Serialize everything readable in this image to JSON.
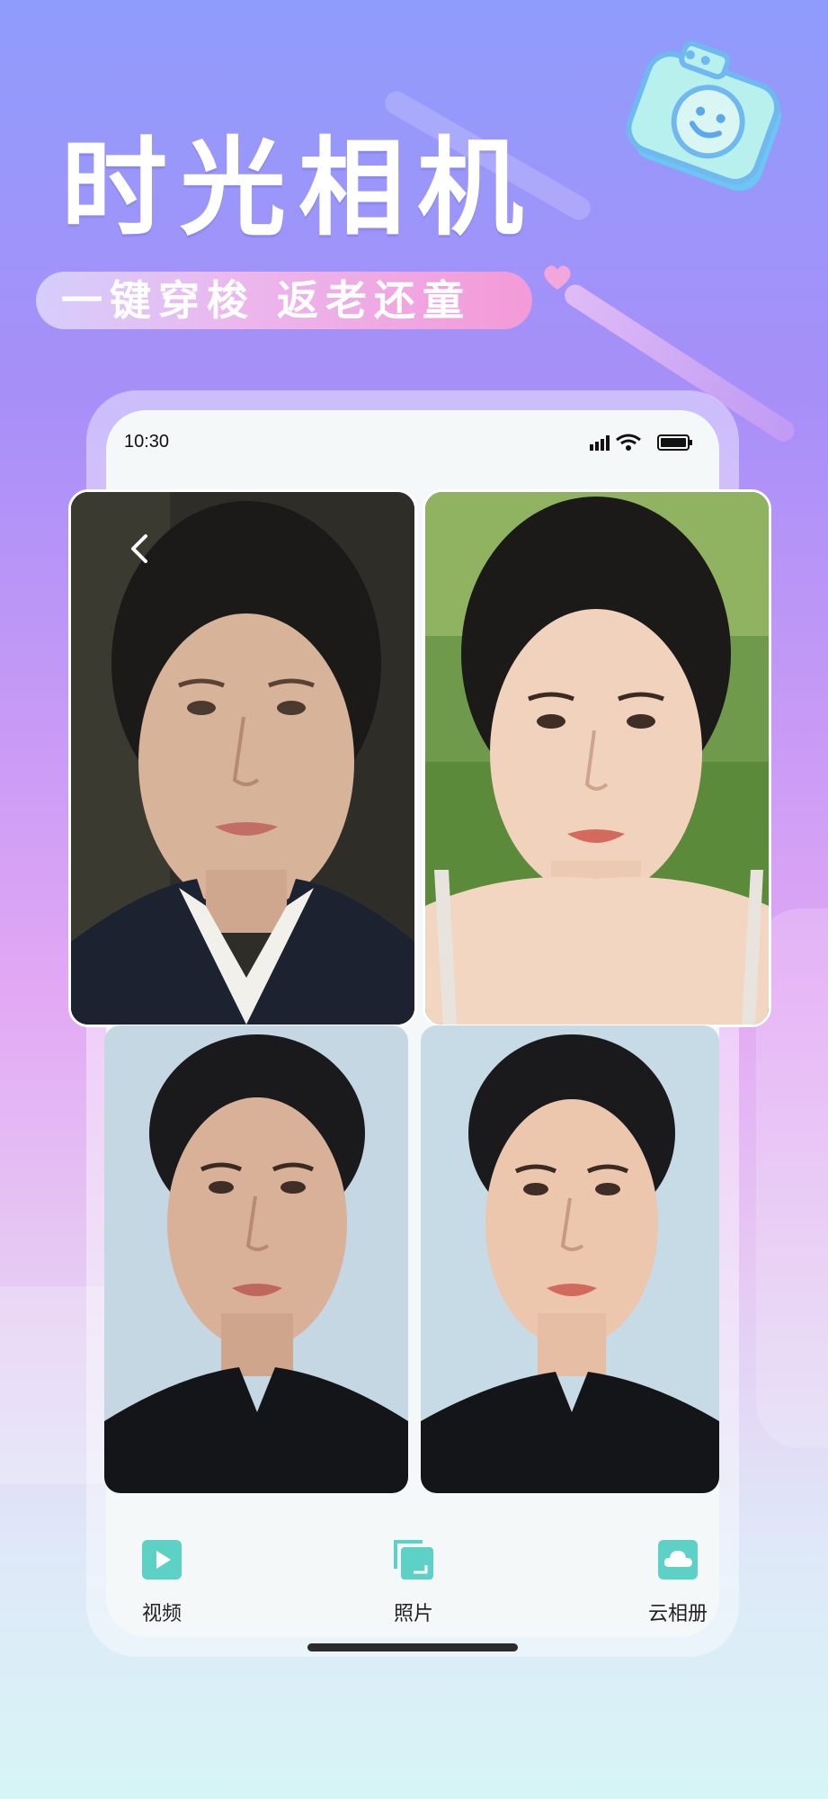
{
  "app": {
    "title": "时光相机",
    "subtitle": "一键穿梭 返老还童"
  },
  "status_bar": {
    "time": "10:30"
  },
  "photos": [
    {
      "label": "aged-woman"
    },
    {
      "label": "young-woman"
    },
    {
      "label": "middle-aged-woman"
    },
    {
      "label": "young-woman-studio"
    }
  ],
  "bottom_nav": {
    "items": [
      {
        "label": "视频",
        "icon": "video-play-icon"
      },
      {
        "label": "照片",
        "icon": "photo-stack-icon"
      },
      {
        "label": "云相册",
        "icon": "cloud-icon"
      }
    ]
  },
  "colors": {
    "accent": "#5ed1c7",
    "pill": "#f39ad7",
    "background_top": "#8f9cfb",
    "background_bottom": "#d6f5f6"
  }
}
